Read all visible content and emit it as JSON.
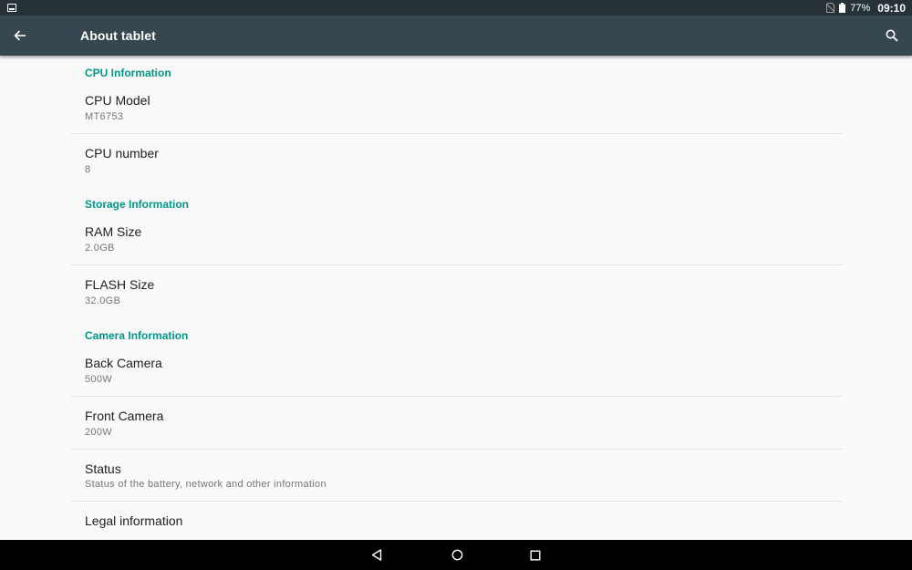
{
  "status_bar": {
    "battery_percent": "77%",
    "time": "09:10",
    "icons": [
      "screenshot-notification-icon",
      "no-sim-icon",
      "battery-icon"
    ]
  },
  "app_bar": {
    "title": "About tablet",
    "icons": [
      "back-arrow-icon",
      "search-icon"
    ]
  },
  "sections": {
    "cpu": {
      "header": "CPU Information",
      "items": [
        {
          "title": "CPU Model",
          "summary": "MT6753"
        },
        {
          "title": "CPU number",
          "summary": "8"
        }
      ]
    },
    "storage": {
      "header": "Storage Information",
      "items": [
        {
          "title": "RAM Size",
          "summary": "2.0GB"
        },
        {
          "title": "FLASH Size",
          "summary": "32.0GB"
        }
      ]
    },
    "camera": {
      "header": "Camera Information",
      "items": [
        {
          "title": "Back Camera",
          "summary": "500W"
        },
        {
          "title": "Front Camera",
          "summary": "200W"
        }
      ]
    }
  },
  "other_items": [
    {
      "title": "Status",
      "summary": "Status of the battery, network and other information"
    },
    {
      "title": "Legal information"
    }
  ],
  "nav_bar": {
    "icons": [
      "back-triangle-icon",
      "home-circle-icon",
      "recents-square-icon"
    ]
  },
  "colors": {
    "status_bar": "#263238",
    "app_bar": "#37474f",
    "accent": "#009688",
    "background": "#fafafa",
    "nav_bar": "#000000"
  }
}
